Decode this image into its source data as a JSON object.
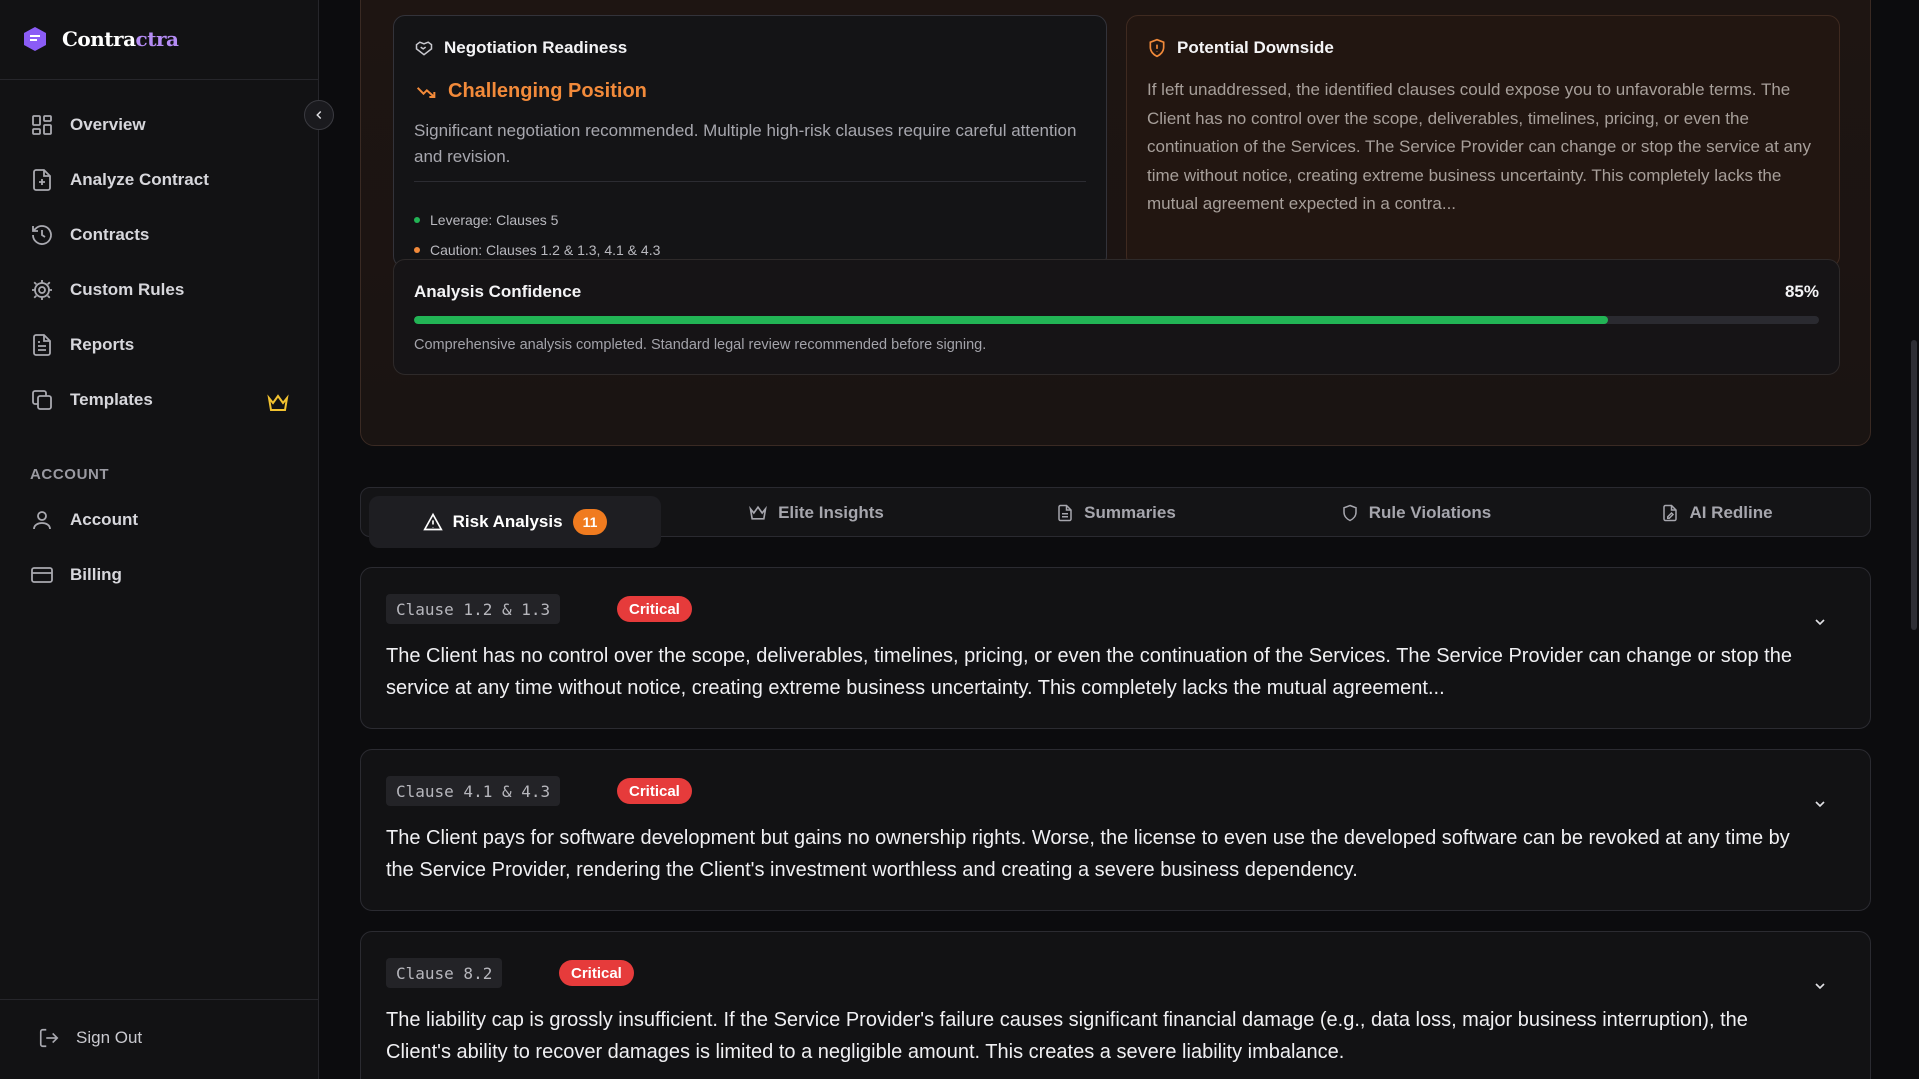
{
  "brand": {
    "name_a": "Contra",
    "name_b": "ctra"
  },
  "sidebar": {
    "items": [
      {
        "label": "Overview",
        "icon": "grid-icon"
      },
      {
        "label": "Analyze Contract",
        "icon": "file-plus-icon"
      },
      {
        "label": "Contracts",
        "icon": "history-icon"
      },
      {
        "label": "Custom Rules",
        "icon": "gear-icon"
      },
      {
        "label": "Reports",
        "icon": "file-text-icon"
      },
      {
        "label": "Templates",
        "icon": "copy-icon",
        "badge_icon": "crown-icon"
      }
    ],
    "section_label": "ACCOUNT",
    "account_items": [
      {
        "label": "Account",
        "icon": "user-icon"
      },
      {
        "label": "Billing",
        "icon": "credit-card-icon"
      }
    ],
    "sign_out": "Sign Out"
  },
  "negotiation": {
    "title": "Negotiation Readiness",
    "position": "Challenging Position",
    "description": "Significant negotiation recommended. Multiple high-risk clauses require careful attention and revision.",
    "leverage": "Leverage: Clauses 5",
    "caution": "Caution: Clauses 1.2 & 1.3, 4.1 & 4.3"
  },
  "downside": {
    "title": "Potential Downside",
    "text": "If left unaddressed, the identified clauses could expose you to unfavorable terms. The Client has no control over the scope, deliverables, timelines, pricing, or even the continuation of the Services. The Service Provider can change or stop the service at any time without notice, creating extreme business uncertainty. This completely lacks the mutual agreement expected in a contra..."
  },
  "confidence": {
    "title": "Analysis Confidence",
    "percent_label": "85%",
    "value": 0.85,
    "note": "Comprehensive analysis completed. Standard legal review recommended before signing."
  },
  "tabs": [
    {
      "label": "Risk Analysis",
      "count": "11"
    },
    {
      "label": "Elite Insights"
    },
    {
      "label": "Summaries"
    },
    {
      "label": "Rule Violations"
    },
    {
      "label": "AI Redline"
    }
  ],
  "risks": [
    {
      "clause": "Clause 1.2 & 1.3",
      "severity": "Critical",
      "text": "The Client has no control over the scope, deliverables, timelines, pricing, or even the continuation of the Services. The Service Provider can change or stop the service at any time without notice, creating extreme business uncertainty. This completely lacks the mutual agreement..."
    },
    {
      "clause": "Clause 4.1 & 4.3",
      "severity": "Critical",
      "text": "The Client pays for software development but gains no ownership rights. Worse, the license to even use the developed software can be revoked at any time by the Service Provider, rendering the Client's investment worthless and creating a severe business dependency."
    },
    {
      "clause": "Clause 8.2",
      "severity": "Critical",
      "text": "The liability cap is grossly insufficient. If the Service Provider's failure causes significant financial damage (e.g., data loss, major business interruption), the Client's ability to recover damages is limited to a negligible amount. This creates a severe liability imbalance."
    }
  ],
  "colors": {
    "accent_orange": "#f28a3a",
    "critical": "#e63b3b",
    "progress": "#22b455",
    "brand_purple": "#8b5cf6"
  }
}
